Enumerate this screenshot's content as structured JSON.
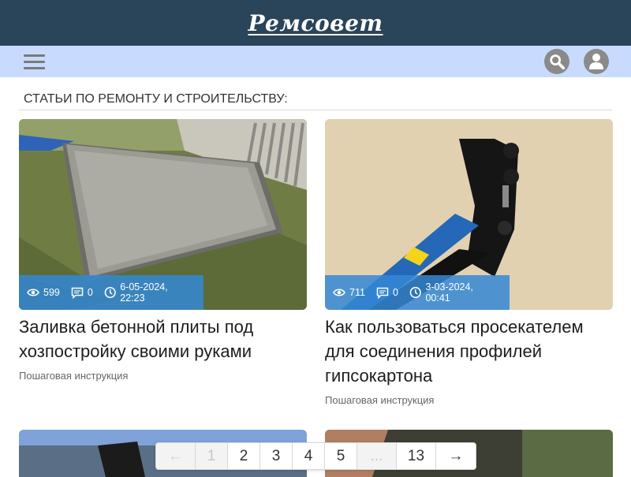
{
  "header": {
    "logo": "Ремсовет"
  },
  "toolbar": {
    "menu_icon": "hamburger-menu-icon",
    "search_icon": "search-icon",
    "user_icon": "user-icon"
  },
  "section": {
    "title": "СТАТЬИ ПО РЕМОНТУ И СТРОИТЕЛЬСТВУ:"
  },
  "articles": [
    {
      "title": "Заливка бетонной плиты под хозпостройку своими руками",
      "category": "Пошаговая инструкция",
      "views": "599",
      "comments": "0",
      "date": "6-05-2024, 22:23"
    },
    {
      "title": "Как пользоваться просекателем для соединения профилей гипсокартона",
      "category": "Пошаговая инструкция",
      "views": "711",
      "comments": "0",
      "date": "3-03-2024, 00:41"
    }
  ],
  "pagination": {
    "prev": "←",
    "pages": [
      "1",
      "2",
      "3",
      "4",
      "5"
    ],
    "dots": "...",
    "last": "13",
    "next": "→",
    "current": "1"
  },
  "colors": {
    "header_bg": "#2a4459",
    "toolbar_bg": "#c8dbff",
    "meta_bg": "#3488d6"
  }
}
